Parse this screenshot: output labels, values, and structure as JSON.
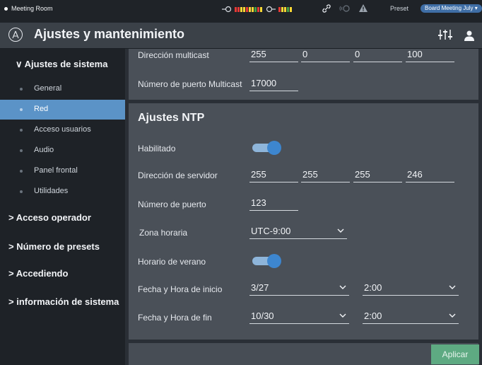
{
  "topbar": {
    "room": "Meeting Room",
    "preset_label": "Preset",
    "preset_value": "Board Meeting July ▾",
    "icons": [
      "input-icon",
      "level-meter-icon",
      "output-icon",
      "level-meter-icon",
      "link-icon",
      "wireless-icon",
      "warning-icon"
    ],
    "colors": {
      "meter_red": "#e53935",
      "meter_yellow": "#fdd835",
      "meter_green": "#43a047"
    }
  },
  "header": {
    "title": "Ajustes y mantenimiento",
    "icons": [
      "logo-icon",
      "mixer-icon",
      "user-icon"
    ]
  },
  "sidebar": {
    "section_system": "∨ Ajustes de sistema",
    "items": [
      {
        "label": "General"
      },
      {
        "label": "Red"
      },
      {
        "label": "Acceso usuarios"
      },
      {
        "label": "Audio"
      },
      {
        "label": "Panel frontal"
      },
      {
        "label": "Utilidades"
      }
    ],
    "active_index": 1,
    "section_operator": "> Acceso operador",
    "section_presets": "> Número de presets",
    "section_accessing": "> Accediendo",
    "section_info": "> información de sistema"
  },
  "multicast": {
    "address_label": "Dirección multicast",
    "address": [
      "255",
      "0",
      "0",
      "100"
    ],
    "port_label": "Número de puerto Multicast",
    "port": "17000"
  },
  "ntp": {
    "title": "Ajustes NTP",
    "enabled_label": "Habilitado",
    "enabled": true,
    "server_label": "Dirección de servidor",
    "server": [
      "255",
      "255",
      "255",
      "246"
    ],
    "port_label": "Número de puerto",
    "port": "123",
    "timezone_label": "Zona horaria",
    "timezone": "UTC-9:00",
    "dst_label": "Horario de verano",
    "dst": true,
    "start_label": "Fecha y Hora de inicio",
    "start_date": "3/27",
    "start_time": "2:00",
    "end_label": "Fecha y Hora de fin",
    "end_date": "10/30",
    "end_time": "2:00"
  },
  "actions": {
    "apply": "Aplicar"
  },
  "theme": {
    "accent": "#5b93c7",
    "toggle_on": "#3d86cf",
    "apply_bg": "#5eaa82"
  }
}
